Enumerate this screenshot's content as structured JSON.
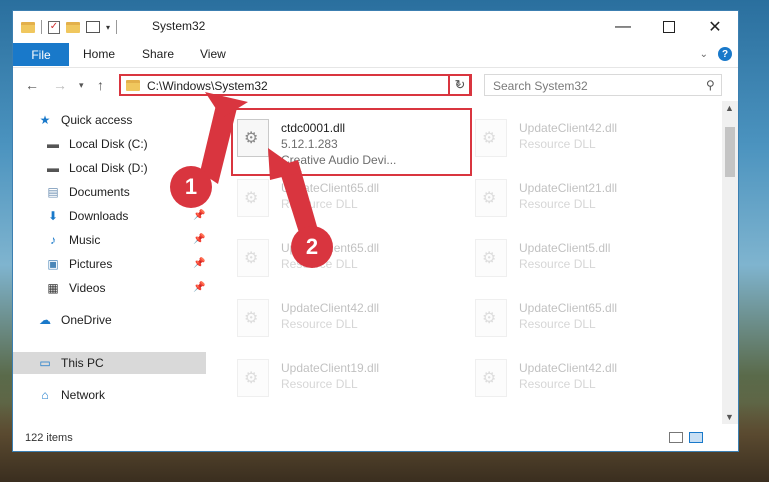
{
  "window": {
    "title": "System32"
  },
  "ribbon": {
    "tabs": [
      "File",
      "Home",
      "Share",
      "View"
    ]
  },
  "address": {
    "path": "C:\\Windows\\System32"
  },
  "search": {
    "placeholder": "Search System32"
  },
  "sidebar": {
    "items": [
      {
        "label": "Quick access",
        "icon": "star-icon"
      },
      {
        "label": "Local Disk (C:)",
        "icon": "drive-icon"
      },
      {
        "label": "Local Disk (D:)",
        "icon": "drive-icon"
      },
      {
        "label": "Documents",
        "icon": "documents-icon",
        "pinned": true
      },
      {
        "label": "Downloads",
        "icon": "download-icon",
        "pinned": true
      },
      {
        "label": "Music",
        "icon": "music-icon",
        "pinned": true
      },
      {
        "label": "Pictures",
        "icon": "pictures-icon",
        "pinned": true
      },
      {
        "label": "Videos",
        "icon": "videos-icon",
        "pinned": true
      },
      {
        "label": "OneDrive",
        "icon": "cloud-icon"
      },
      {
        "label": "This PC",
        "icon": "computer-icon",
        "selected": true
      },
      {
        "label": "Network",
        "icon": "network-icon"
      }
    ]
  },
  "files": [
    {
      "name": "ctdc0001.dll",
      "line1": "5.12.1.283",
      "line2": "Creative Audio Devi..."
    },
    {
      "name": "UpdateClient42.dll",
      "line1": "Resource DLL"
    },
    {
      "name": "UpdateClient65.dll",
      "line1": "Resource DLL"
    },
    {
      "name": "UpdateClient21.dll",
      "line1": "Resource DLL"
    },
    {
      "name": "UpdateClient65.dll",
      "line1": "Resource DLL"
    },
    {
      "name": "UpdateClient5.dll",
      "line1": "Resource DLL"
    },
    {
      "name": "UpdateClient42.dll",
      "line1": "Resource DLL"
    },
    {
      "name": "UpdateClient65.dll",
      "line1": "Resource DLL"
    },
    {
      "name": "UpdateClient19.dll",
      "line1": "Resource DLL"
    },
    {
      "name": "UpdateClient42.dll",
      "line1": "Resource DLL"
    }
  ],
  "status": {
    "count": "122 items"
  },
  "markers": [
    "1",
    "2"
  ],
  "colors": {
    "accent": "#1979ca",
    "highlight": "#d9353f"
  }
}
